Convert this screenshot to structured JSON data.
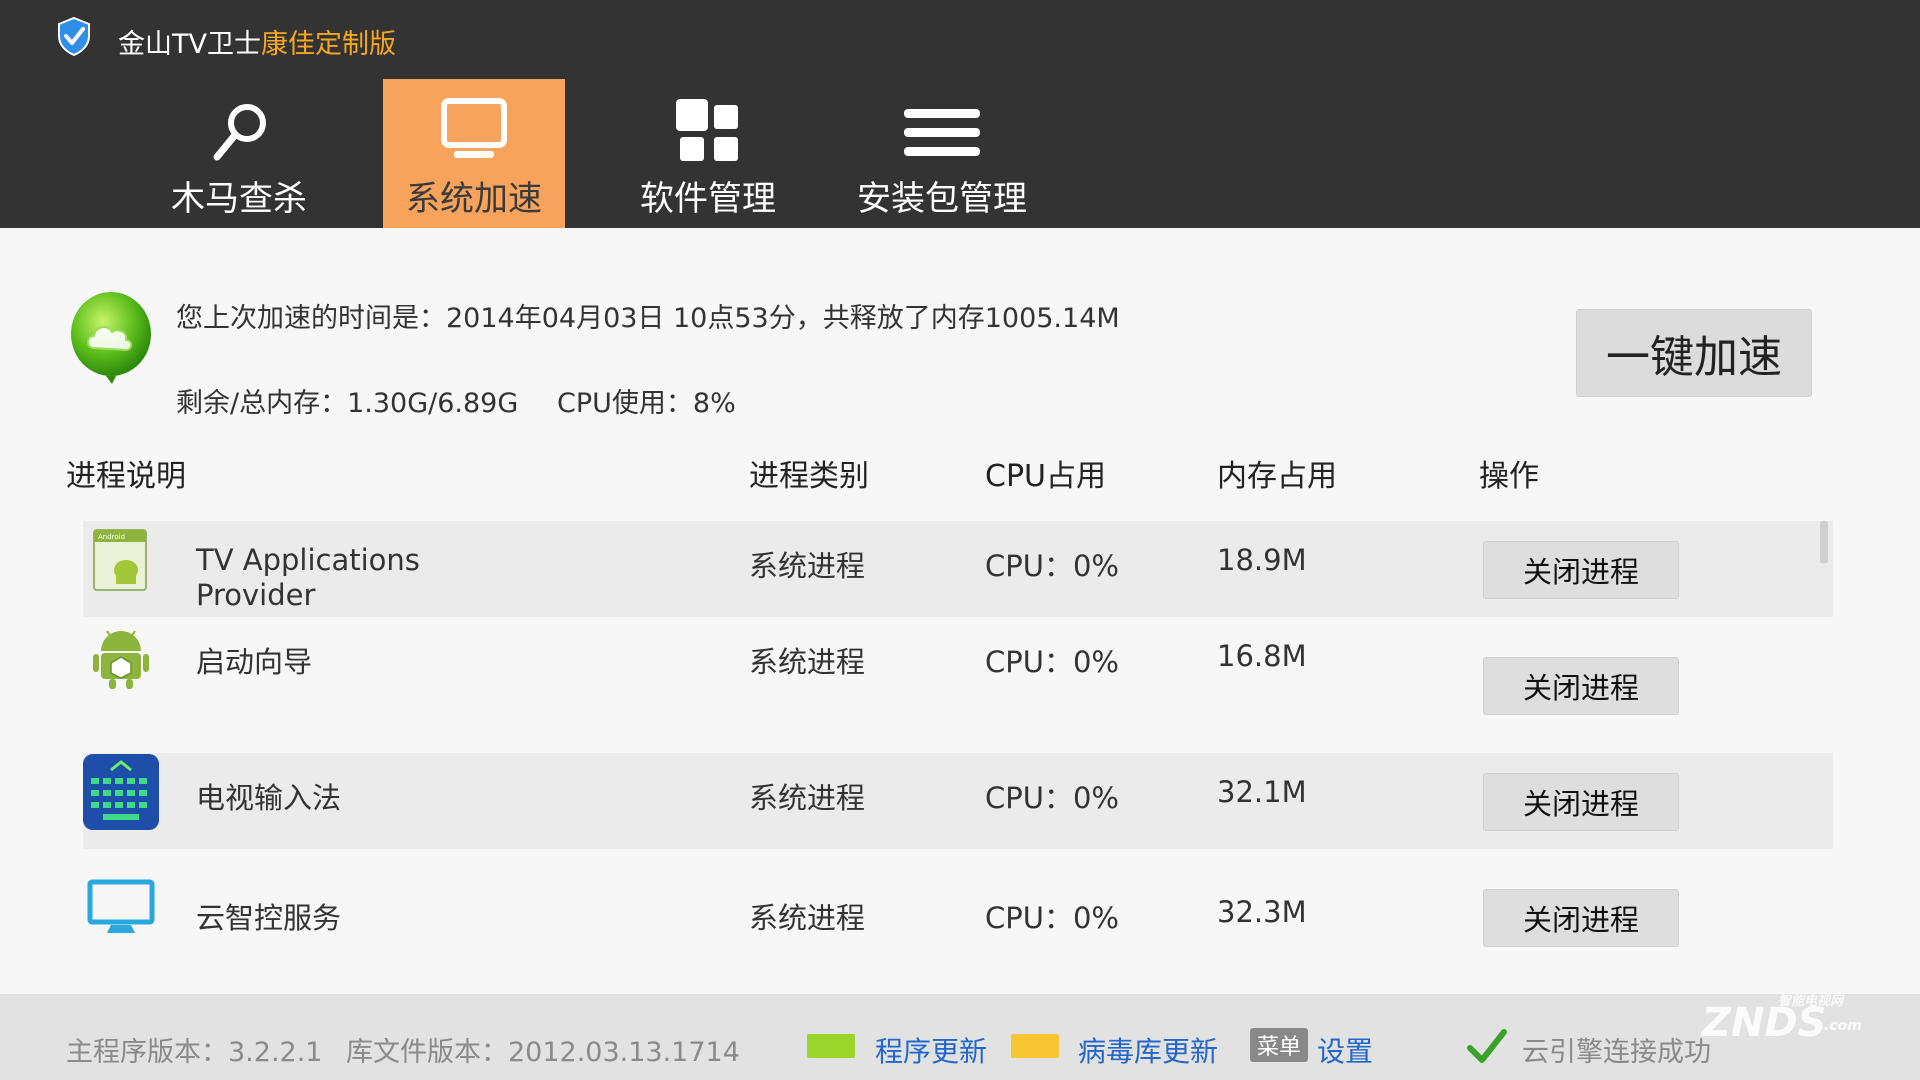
{
  "app": {
    "title_main": "金山TV卫士",
    "title_edition": "康佳定制版"
  },
  "tabs": [
    {
      "label": "木马查杀",
      "icon": "search-icon",
      "active": false
    },
    {
      "label": "系统加速",
      "icon": "monitor-icon",
      "active": true
    },
    {
      "label": "软件管理",
      "icon": "grid-icon",
      "active": false
    },
    {
      "label": "安装包管理",
      "icon": "list-icon",
      "active": false
    }
  ],
  "info": {
    "last_speed": "您上次加速的时间是：2014年04月03日 10点53分，共释放了内存1005.14M",
    "memory": "剩余/总内存：1.30G/6.89G",
    "cpu": "CPU使用：8%",
    "speed_button": "一键加速"
  },
  "table": {
    "headers": [
      "进程说明",
      "进程类别",
      "CPU占用",
      "内存占用",
      "操作"
    ],
    "rows": [
      {
        "name_line1": "TV Applications",
        "name_line2": "Provider",
        "type": "系统进程",
        "cpu": "CPU：0%",
        "mem": "18.9M",
        "action": "关闭进程",
        "icon": "android-app-icon"
      },
      {
        "name_line1": "启动向导",
        "name_line2": "",
        "type": "系统进程",
        "cpu": "CPU：0%",
        "mem": "16.8M",
        "action": "关闭进程",
        "icon": "android-robot-icon"
      },
      {
        "name_line1": "电视输入法",
        "name_line2": "",
        "type": "系统进程",
        "cpu": "CPU：0%",
        "mem": "32.1M",
        "action": "关闭进程",
        "icon": "keyboard-icon"
      },
      {
        "name_line1": "云智控服务",
        "name_line2": "",
        "type": "系统进程",
        "cpu": "CPU：0%",
        "mem": "32.3M",
        "action": "关闭进程",
        "icon": "monitor-icon"
      }
    ]
  },
  "footer": {
    "main_version": "主程序版本：3.2.2.1",
    "db_version": "库文件版本：2012.03.13.1714",
    "program_update": "程序更新",
    "virus_update": "病毒库更新",
    "menu_badge": "菜单",
    "settings": "设置",
    "cloud_status": "云引擎连接成功",
    "colors": {
      "program_update": "#9bd42a",
      "virus_update": "#f7c531",
      "link": "#2466c9"
    }
  },
  "watermark": {
    "logo": "ZNDS",
    "sub": "智能电视网",
    "suffix": ".com"
  }
}
